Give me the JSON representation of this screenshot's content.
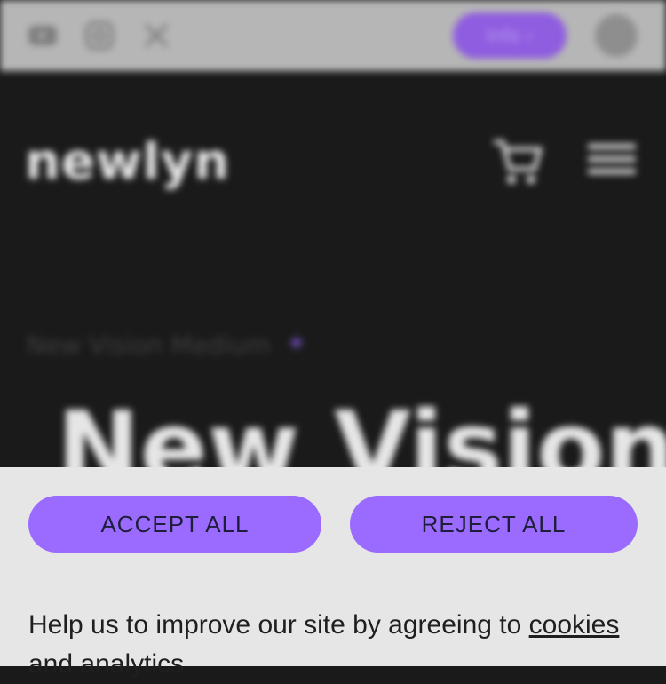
{
  "topbar": {
    "social_icons": [
      "youtube-icon",
      "instagram-icon",
      "x-icon"
    ],
    "pill_label": "Info ›",
    "account_icon": "user-icon"
  },
  "header": {
    "logo": "newlyn",
    "cart_icon": "cart-icon",
    "menu_icon": "hamburger-icon"
  },
  "hero": {
    "breadcrumb": "New Vision Medium",
    "breadcrumb_marker": "✦",
    "title": "New Vision"
  },
  "consent": {
    "accept_label": "ACCEPT ALL",
    "reject_label": "REJECT ALL",
    "text_prefix": "Help us to improve our site by agreeing to ",
    "cookies_link": "cookies",
    "text_suffix": "and analytics"
  },
  "colors": {
    "accent": "#9b6bff",
    "banner_bg": "#e6e6e6",
    "header_bg": "#1a1a1a",
    "topbar_bg": "#b6b6b6"
  }
}
